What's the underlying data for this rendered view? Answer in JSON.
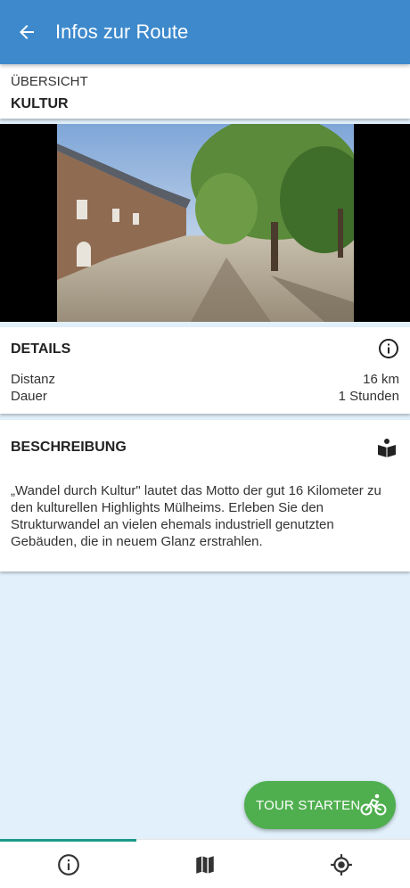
{
  "appbar": {
    "title": "Infos zur Route",
    "back_icon": "arrow-back-icon"
  },
  "overview": {
    "label": "ÜBERSICHT",
    "category": "KULTUR"
  },
  "details": {
    "title": "DETAILS",
    "rows": [
      {
        "label": "Distanz",
        "value": "16 km"
      },
      {
        "label": "Dauer",
        "value": "1 Stunden"
      }
    ]
  },
  "description": {
    "title": "BESCHREIBUNG",
    "text": "„Wandel durch Kultur\" lautet das Motto der gut 16 Kilometer zu den kulturellen Highlights Mülheims. Erleben Sie den Strukturwandel an vielen ehemals industriell genutzten Gebäuden, die in neuem Glanz erstrahlen."
  },
  "fab": {
    "label": "TOUR STARTEN",
    "icon": "bicycle-icon"
  },
  "bottom_nav": {
    "items": [
      {
        "icon": "info-icon",
        "active": true
      },
      {
        "icon": "map-icon",
        "active": false
      },
      {
        "icon": "location-target-icon",
        "active": false
      }
    ]
  },
  "colors": {
    "appbar": "#3d89cc",
    "background": "#e1f0fb",
    "fab": "#4faf4f",
    "nav_indicator": "#1b9a8a"
  }
}
